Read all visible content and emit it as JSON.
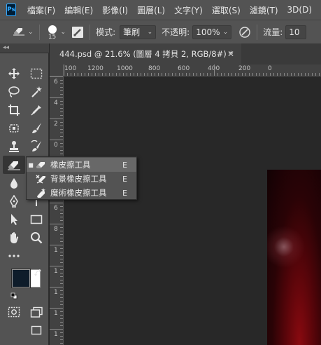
{
  "app": {
    "logo_text": "Ps"
  },
  "menu": [
    "檔案(F)",
    "編輯(E)",
    "影像(I)",
    "圖層(L)",
    "文字(Y)",
    "選取(S)",
    "濾鏡(T)",
    "3D(D)"
  ],
  "options": {
    "brush_size": "15",
    "mode_label": "模式:",
    "mode_value": "筆刷",
    "opacity_label": "不透明:",
    "opacity_value": "100%",
    "flow_label": "流量:",
    "flow_value": "10"
  },
  "toolbar": {
    "collapse_glyph": "◂◂"
  },
  "document": {
    "tab_title": "444.psd @ 21.6% (圖層 4 拷貝 2, RGB/8#) *",
    "close_glyph": "✕"
  },
  "ruler": {
    "h_labels": [
      "100",
      "1200",
      "1000",
      "800",
      "600",
      "400",
      "200",
      "0"
    ],
    "v_labels": [
      "6",
      "4",
      "2",
      "0",
      "2",
      "4",
      "6",
      "8",
      "1",
      "1",
      "1",
      "1",
      "1"
    ]
  },
  "flyout": {
    "items": [
      {
        "label": "橡皮擦工具",
        "shortcut": "E",
        "icon": "eraser-icon",
        "selected": true
      },
      {
        "label": "背景橡皮擦工具",
        "shortcut": "E",
        "icon": "background-eraser-icon",
        "selected": false
      },
      {
        "label": "魔術橡皮擦工具",
        "shortcut": "E",
        "icon": "magic-eraser-icon",
        "selected": false
      }
    ]
  },
  "colors": {
    "foreground": "#0e1c2a",
    "background": "#ffffff",
    "accent": "#31a8ff"
  }
}
